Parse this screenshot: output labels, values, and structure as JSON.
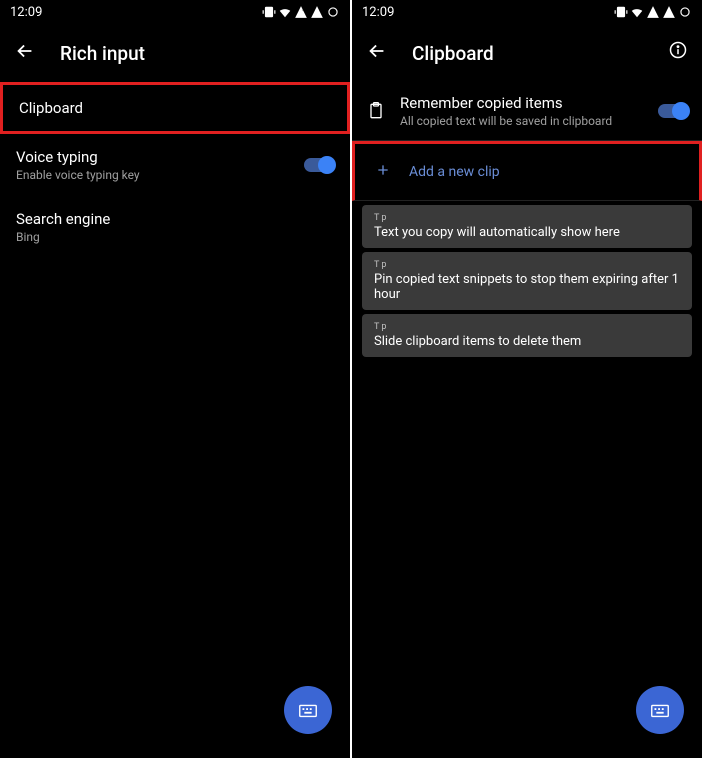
{
  "statusbar": {
    "time": "12:09"
  },
  "left": {
    "header": {
      "title": "Rich input"
    },
    "items": [
      {
        "title": "Clipboard",
        "sub": "",
        "toggle": false,
        "highlight": true
      },
      {
        "title": "Voice typing",
        "sub": "Enable voice typing key",
        "toggle": true,
        "highlight": false
      },
      {
        "title": "Search engine",
        "sub": "Bing",
        "toggle": false,
        "highlight": false
      }
    ]
  },
  "right": {
    "header": {
      "title": "Clipboard"
    },
    "remember": {
      "title": "Remember copied items",
      "sub": "All copied text will be saved in clipboard"
    },
    "addnew": {
      "label": "Add a new clip",
      "highlight": true
    },
    "tips": [
      {
        "label": "T p",
        "text": "Text you copy will automatically show here"
      },
      {
        "label": "T p",
        "text": "Pin copied text snippets to stop them expiring after 1 hour"
      },
      {
        "label": "T p",
        "text": "Slide clipboard items to delete them"
      }
    ]
  }
}
